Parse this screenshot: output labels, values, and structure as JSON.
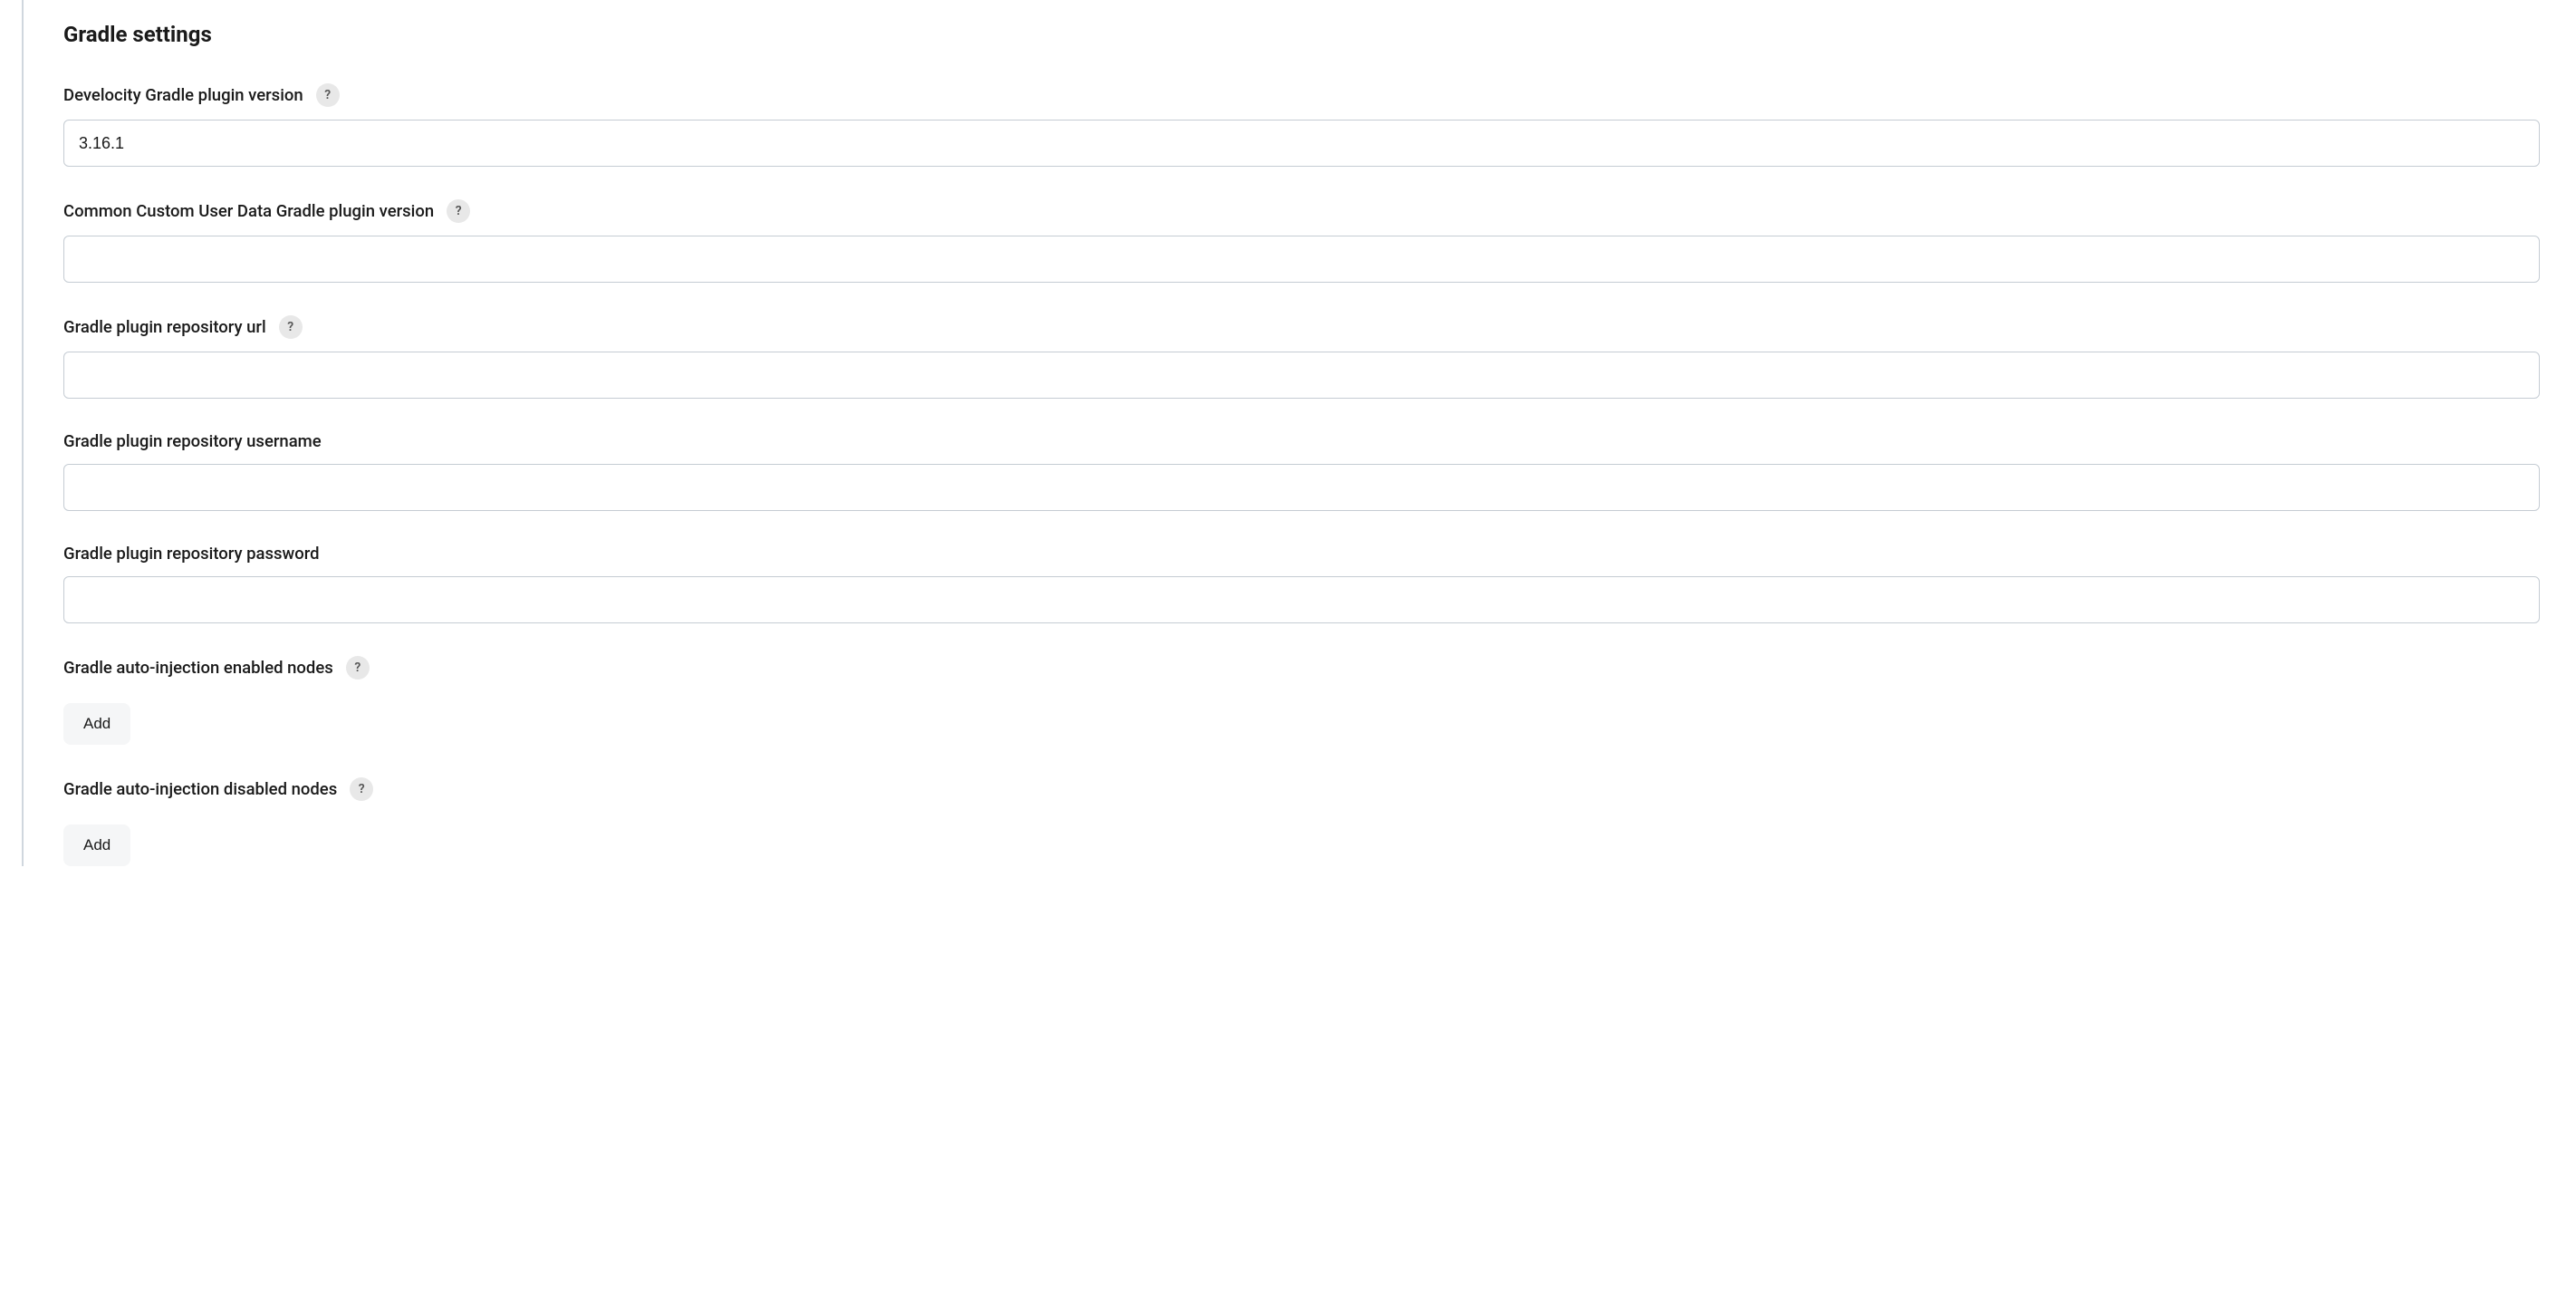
{
  "section": {
    "title": "Gradle settings"
  },
  "fields": {
    "develocityPluginVersion": {
      "label": "Develocity Gradle plugin version",
      "value": "3.16.1",
      "hasHelp": true
    },
    "ccudPluginVersion": {
      "label": "Common Custom User Data Gradle plugin version",
      "value": "",
      "hasHelp": true
    },
    "repoUrl": {
      "label": "Gradle plugin repository url",
      "value": "",
      "hasHelp": true
    },
    "repoUsername": {
      "label": "Gradle plugin repository username",
      "value": "",
      "hasHelp": false
    },
    "repoPassword": {
      "label": "Gradle plugin repository password",
      "value": "",
      "hasHelp": false
    },
    "enabledNodes": {
      "label": "Gradle auto-injection enabled nodes",
      "addLabel": "Add",
      "hasHelp": true
    },
    "disabledNodes": {
      "label": "Gradle auto-injection disabled nodes",
      "addLabel": "Add",
      "hasHelp": true
    }
  },
  "helpGlyph": "?"
}
